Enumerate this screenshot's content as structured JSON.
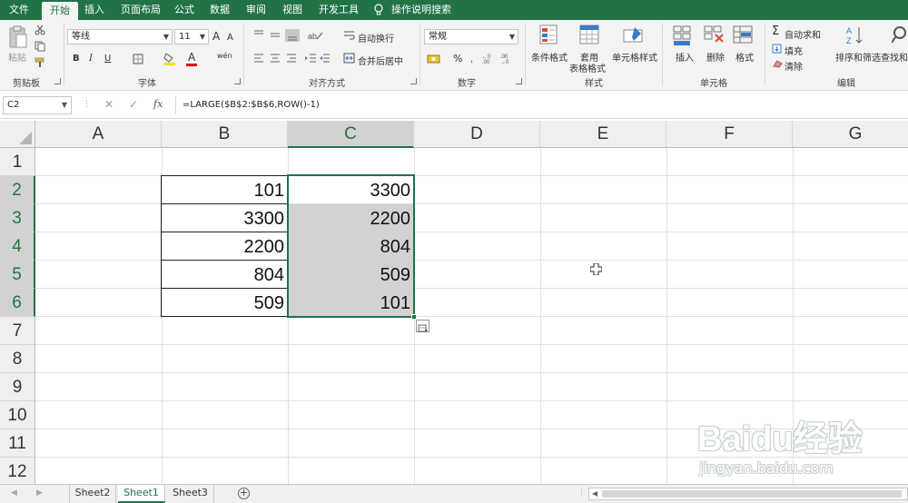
{
  "tabs": {
    "file": "文件",
    "home": "开始",
    "insert": "插入",
    "page_layout": "页面布局",
    "formulas": "公式",
    "data": "数据",
    "review": "审阅",
    "view": "视图",
    "developer": "开发工具",
    "tell_me": "操作说明搜索"
  },
  "ribbon": {
    "clipboard": {
      "label": "剪贴板",
      "paste": "粘贴"
    },
    "font": {
      "label": "字体",
      "name": "等线",
      "size": "11",
      "bold": "B",
      "italic": "I",
      "underline": "U",
      "grow": "A",
      "shrink": "A",
      "font_color": "A",
      "phonetic": "wén"
    },
    "alignment": {
      "label": "对齐方式",
      "wrap": "自动换行",
      "merge": "合并后居中"
    },
    "number": {
      "label": "数字",
      "format": "常规",
      "percent": "%"
    },
    "styles": {
      "label": "样式",
      "cond_format": "条件格式",
      "table_format_1": "套用",
      "table_format_2": "表格格式",
      "cell_styles": "单元格样式"
    },
    "cells": {
      "label": "单元格",
      "insert": "插入",
      "delete": "删除",
      "format": "格式"
    },
    "editing": {
      "label": "编辑",
      "autosum": "自动求和",
      "fill": "填充",
      "clear": "清除",
      "sort_filter": "排序和筛选",
      "find_select": "查找和"
    }
  },
  "formula_bar": {
    "name_box": "C2",
    "cancel": "✕",
    "enter": "✓",
    "fx": "fx",
    "formula": "=LARGE($B$2:$B$6,ROW()-1)"
  },
  "grid": {
    "columns": [
      "A",
      "B",
      "C",
      "D",
      "E",
      "F",
      "G"
    ],
    "rows": [
      "1",
      "2",
      "3",
      "4",
      "5",
      "6",
      "7",
      "8",
      "9",
      "10",
      "11",
      "12"
    ],
    "col_b": [
      "101",
      "3300",
      "2200",
      "804",
      "509"
    ],
    "col_c": [
      "3300",
      "2200",
      "804",
      "509",
      "101"
    ]
  },
  "sheets": [
    "Sheet2",
    "Sheet1",
    "Sheet3"
  ],
  "add_sheet": "+",
  "watermark": {
    "main": "Baidu经验",
    "url": "jingyan.baidu.com"
  },
  "colors": {
    "accent": "#217346",
    "selection_fill": "#d2d2d2"
  }
}
